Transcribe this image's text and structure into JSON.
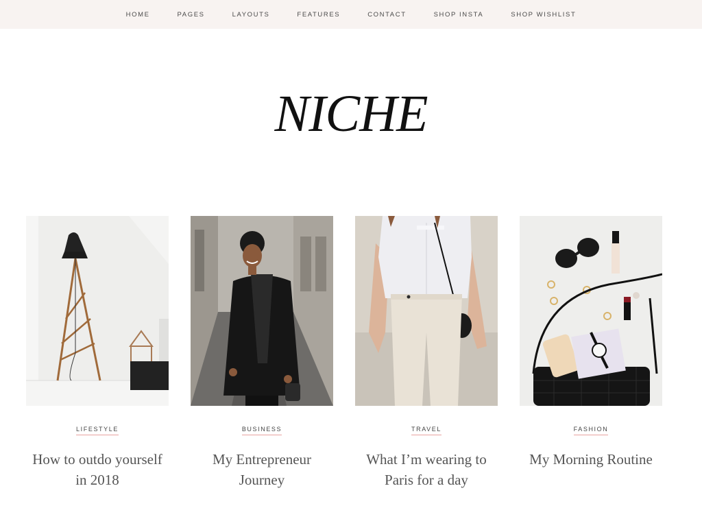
{
  "nav": {
    "items": [
      "HOME",
      "PAGES",
      "LAYOUTS",
      "FEATURES",
      "CONTACT",
      "SHOP INSTA",
      "SHOP WISHLIST"
    ]
  },
  "site": {
    "logo": "NICHE"
  },
  "posts": [
    {
      "category": "LIFESTYLE",
      "title": "How to outdo yourself in 2018"
    },
    {
      "category": "BUSINESS",
      "title": "My Entrepreneur Journey"
    },
    {
      "category": "TRAVEL",
      "title": "What I’m wearing to Paris for a day"
    },
    {
      "category": "FASHION",
      "title": "My Morning Routine"
    }
  ],
  "colors": {
    "nav_bg": "#f8f3f1",
    "accent_underline": "#e7a2a0",
    "logo": "#111111"
  }
}
